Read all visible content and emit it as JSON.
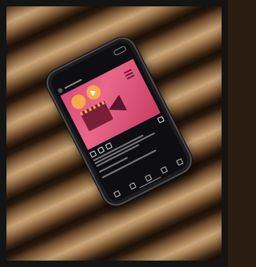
{
  "scene": {
    "description_type": "photo",
    "background_material": "wooden-slats",
    "device": "smartphone"
  },
  "phone_screen": {
    "app_title": "",
    "post_colors": {
      "background": "#e0567f",
      "accent": "#f5a74a",
      "dark": "#7a1f3a"
    }
  }
}
